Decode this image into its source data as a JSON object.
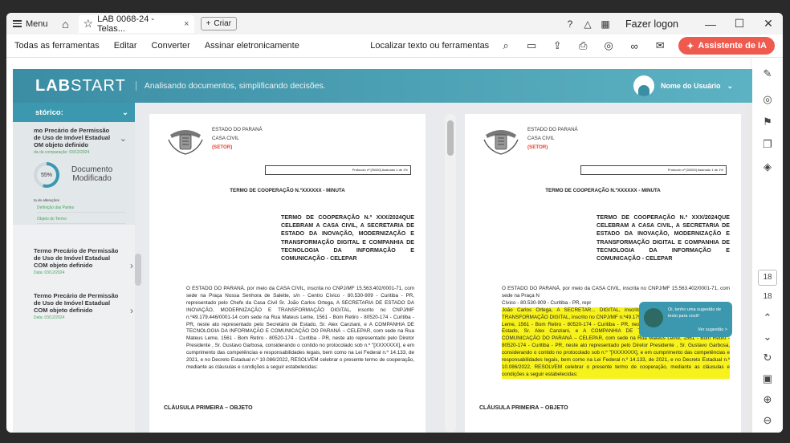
{
  "titlebar": {
    "menu": "Menu",
    "tab_title": "LAB 0068-24 - Telas...",
    "tab_close": "×",
    "create": "Criar",
    "login": "Fazer logon"
  },
  "toolbar": {
    "all_tools": "Todas as ferramentas",
    "edit": "Editar",
    "convert": "Converter",
    "sign": "Assinar eletronicamente",
    "search": "Localizar texto ou ferramentas",
    "ai": "Assistente de IA"
  },
  "rail": {
    "page1": "18",
    "page2": "18"
  },
  "app": {
    "logo_a": "LAB",
    "logo_b": "START",
    "tagline": "Analisando documentos, simplificando decisões.",
    "user": "Nome do Usuário"
  },
  "sidebar": {
    "history": "stórico:",
    "card1": {
      "title": "mo Precário de Permissão\nde Uso de Imóvel Estadual\nOM objeto definido",
      "date": "da da comparação: 03/12/2024",
      "percent": "55%",
      "status": "Documento\nModificado",
      "alts": "ta de alterações",
      "items": [
        "Definição das Partes",
        "Objeto do Termo"
      ]
    },
    "cards": [
      {
        "title": "Termo Precário de Permissão\nde Uso de Imóvel Estadual\nCOM objeto definido",
        "date": "Data: 03/12/2024"
      },
      {
        "title": "Termo Precário de Permissão\nde Uso de Imóvel Estadual\nCOM objeto definido",
        "date": "Data: 03/12/2024"
      }
    ]
  },
  "document": {
    "state": "ESTADO DO PARANÁ",
    "dept": "CASA CIVIL",
    "setor": "(SETOR)",
    "protocol": "Protocolo nº [00000] Assinado 1 de 1%",
    "title": "TERMO DE COOPERAÇÃO N.ºXXXXXX - MINUTA",
    "summary": "TERMO DE COOPERAÇÃO N.º XXX/2024QUE CELEBRAM A CASA CIVIL, A SECRETARIA DE ESTADO DA INOVAÇÃO, MODERNIZAÇÃO E TRANSFORMAÇÃO DIGITAL E COMPANHIA DE TECNOLOGIA DA INFORMAÇÃO E COMUNICAÇÃO - CELEPAR",
    "body": "O ESTADO DO PARANÁ, por meio da CASA CIVIL, inscrita no CNPJ/MF 15.563.402/0001-71, com sede na Praça Nossa Senhora de Salette, s/n - Centro Cívico - 80.530-909 - Curitiba - PR, representado pelo Chefe da Casa Civil Sr. João Carlos Ortega, A SECRETARIA DE ESTADO DA INOVAÇÃO, MODERNIZAÇÃO E TRANSFORMAÇÃO DIGITAL, inscrito no CNPJ/MF n.º49.179.446/0001-14 com sede na Rua Mateus Leme, 1561 - Bom Retiro - 80520-174 - Curitiba - PR, neste ato representado pelo Secretário de Estado, Sr. Alex Canziani, e A COMPANHIA DE TECNOLOGIA DA INFORMAÇÃO E COMUNICAÇÃO DO PARANÁ – CELEPAR, com sede na Rua Mateus Leme, 1561 - Bom Retiro - 80520-174 - Curitiba - PR, neste ato representado pelo Diretor Presidente , Sr. Gustavo Garbosa, considerando o contido no protocolado sob n.º \"[XXXXXXX], e em cumprimento das competências e responsabilidades legais, bem como na Lei Federal n.º 14.133, de 2021, e no Decreto Estadual n.º 10.086/2022, RESOLVEM celebrar o presente termo de cooperação, mediante as cláusulas e condições a seguir estabelecidas:",
    "body_right_a": "O ESTADO DO PARANÁ, por meio da CASA CIVIL, inscrita no CNPJ/MF 15.563.402/0001-71, com sede na Praça N",
    "body_right_b": "Cívico - 80.530-909 - Curitiba - PR, repr",
    "body_right_hl": "João Carlos Ortega, A SECRETAR... DIGITAL, inscrito no CNPJ/MF MODERNIZAÇÃO E TRANSFORMAÇÃO DIGITAL, inscrito no CNPJ/MF n.º49.179.446/0001-14 com sede na Rua Mateus Leme, 1561 - Bom Retiro - 80520-174 - Curitiba - PR, neste ato representado pelo Secretário de Estado, Sr. Alex Canziani, e A COMPANHIA DE TECNOLOGIA DA INFORMAÇÃO E COMUNICAÇÃO DO PARANÁ – CELEPAR, com sede na Rua Mateus Leme, 1561 - Bom Retiro - 80520-174 - Curitiba - PR, neste ato representado pelo Diretor Presidente , Sr. Gustavo Garbosa, considerando o contido no protocolado sob n.º \"[XXXXXXX], e em cumprimento das competências e responsabilidades legais, bem como na Lei Federal n.º 14.133, de 2021, e no Decreto Estadual n.º 10.086/2022, RESOLVEM celebrar o presente termo de cooperação, mediante as cláusulas e condições a seguir estabelecidas:",
    "clause": "CLÁUSULA PRIMEIRA – OBJETO"
  },
  "tip": {
    "text": "Oi, tenho uma sugestão de texto para você!",
    "link": "Ver sugestão >"
  }
}
